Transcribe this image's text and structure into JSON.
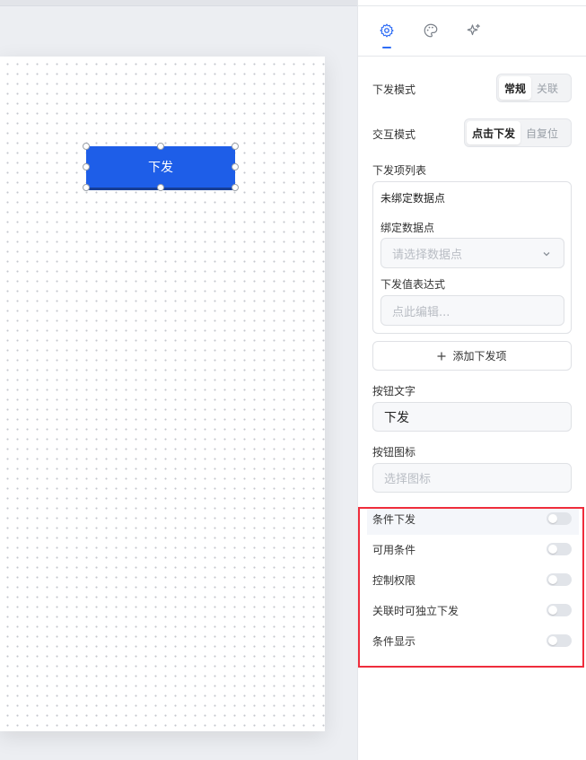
{
  "canvas": {
    "widget_button_label": "下发",
    "widget_color": "#1e5ee8"
  },
  "panel": {
    "tabs": [
      {
        "icon": "gear-icon",
        "active": true
      },
      {
        "icon": "palette-icon",
        "active": false
      },
      {
        "icon": "sparkle-icon",
        "active": false
      }
    ],
    "accent_color": "#2f6df5",
    "issue_mode": {
      "label": "下发模式",
      "options": [
        "常规",
        "关联"
      ],
      "selected": "常规"
    },
    "interaction_mode": {
      "label": "交互模式",
      "options": [
        "点击下发",
        "自复位"
      ],
      "selected": "点击下发"
    },
    "issue_list": {
      "label": "下发项列表",
      "item_title": "未绑定数据点",
      "bind_label": "绑定数据点",
      "bind_placeholder": "请选择数据点",
      "expr_label": "下发值表达式",
      "expr_placeholder": "点此编辑..."
    },
    "add_item_label": "添加下发项",
    "button_text": {
      "label": "按钮文字",
      "value": "下发"
    },
    "button_icon": {
      "label": "按钮图标",
      "placeholder": "选择图标"
    },
    "toggles": [
      {
        "label": "条件下发",
        "on": false
      },
      {
        "label": "可用条件",
        "on": false
      },
      {
        "label": "控制权限",
        "on": false
      },
      {
        "label": "关联时可独立下发",
        "on": false
      },
      {
        "label": "条件显示",
        "on": false
      }
    ],
    "highlight_color": "#ef2d3c"
  }
}
